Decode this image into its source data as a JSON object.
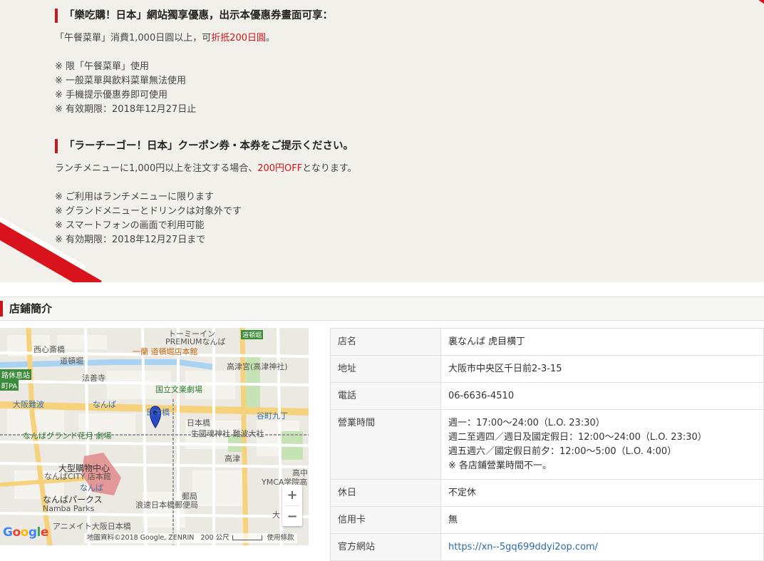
{
  "coupon": {
    "zh": {
      "heading": "「樂吃購！日本」網站獨享優惠，出示本優惠券畫面可享：",
      "offer_prefix": "「午餐菜單」消費1,000日圓以上，可",
      "offer_highlight": "折抵200日圓",
      "offer_suffix": "。",
      "notes": [
        "※ 限「午餐菜單」使用",
        "※ 一般菜單與飲料菜單無法使用",
        "※ 手機提示優惠券即可使用",
        "※ 有效期限：2018年12月27日止"
      ]
    },
    "ja": {
      "heading": "「ラーチーゴー！日本」クーポン券・本券をご提示ください。",
      "offer_prefix": "ランチメニューに1,000円以上を注文する場合、",
      "offer_highlight": "200円OFF",
      "offer_suffix": "となります。",
      "notes": [
        "※ ご利用はランチメニューに限ります",
        "※ グランドメニューとドリンクは対象外です",
        "※ スマートフォンの画面で利用可能",
        "※ 有効期限：2018年12月27日まで"
      ]
    }
  },
  "shop": {
    "section_title": "店鋪簡介",
    "rows": [
      {
        "key": "店名",
        "value": "裏なんば 虎目横丁"
      },
      {
        "key": "地址",
        "value": "大阪市中央区千日前2-3-15"
      },
      {
        "key": "電話",
        "value": "06-6636-4510"
      },
      {
        "key": "營業時間",
        "lines": [
          "週一：17:00～24:00（L.O. 23:30）",
          "週二至週四／週日及國定假日：12:00～24:00（L.O. 23:30）",
          "週五週六／國定假日前夕：12:00～5:00（L.O. 4:00）",
          "※ 各店鋪營業時間不一。"
        ]
      },
      {
        "key": "休日",
        "value": "不定休"
      },
      {
        "key": "信用卡",
        "value": "無"
      },
      {
        "key": "官方網站",
        "value": "https://xn--5gq699ddyi2op.com/"
      }
    ]
  },
  "map": {
    "labels": {
      "premium": "PREMIUMなんば",
      "dotonbori_rebel": "トーミーイン",
      "dotonbori_stop": "道頓堀",
      "nishishinsaibashi": "西心斎橋",
      "ichiran": "一蘭 道頓堀店本館",
      "dotonbori": "道頓堀",
      "rest_area": "路休息站",
      "pa": "町PA",
      "hozenji": "法善寺",
      "kozu_shrine": "高津宮(高津神社)",
      "bunraku": "国立文楽劇場",
      "osaka_namba": "大阪難波",
      "namba": "なんば",
      "nipponbashi": "日本橋",
      "tanimachi": "谷町九丁",
      "namba_grand": "なんばグランド花月 劇場",
      "kanezo_shrine": "生國魂神社 難波大社",
      "nihonbashi": "日本橋",
      "kozu": "高津",
      "big_shopping": "大型購物中心",
      "namba_city": "なんばCITY 店本館",
      "namba2": "なんば",
      "ymca": "YMCA学院高",
      "namba_parks": "なんばパークス",
      "namba_parks_en": "Namba Parks",
      "post": "郵局",
      "post2": "浪速日本橋郵便局",
      "animate": "アニメイト大阪日本橋",
      "dai": "大",
      "kouchuu": "高中",
      "footer_data": "地圖資料©2018 Google, ZENRIN",
      "footer_scale": "200 公尺",
      "footer_terms": "使用條款",
      "google": "Google",
      "zoom_in": "+",
      "zoom_out": "−"
    }
  }
}
